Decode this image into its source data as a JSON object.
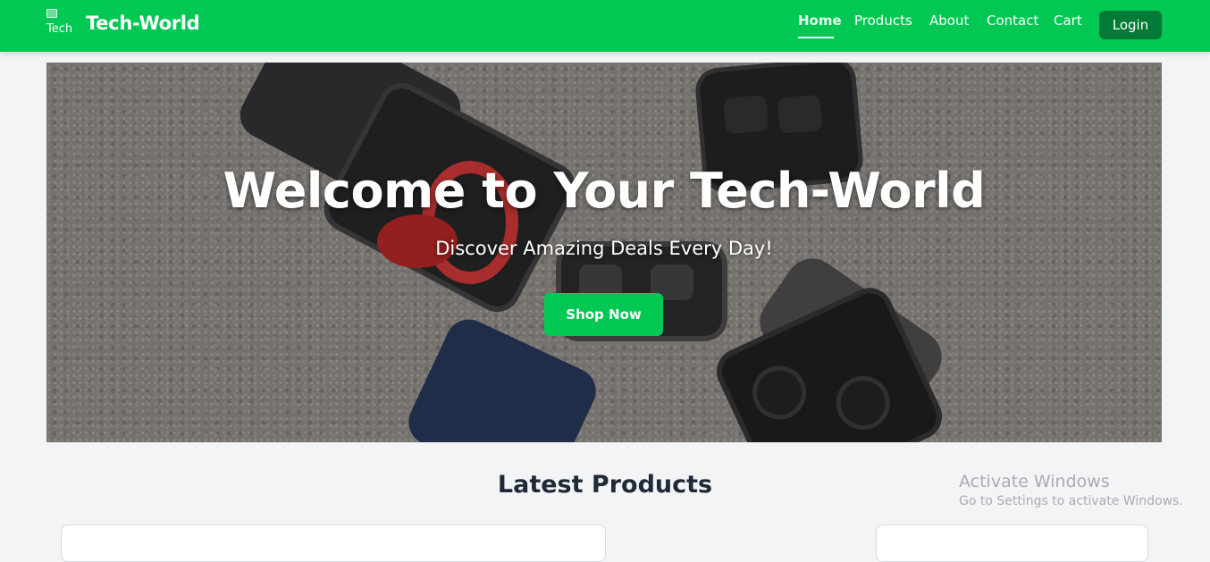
{
  "nav": {
    "logo_alt": "Tech",
    "brand": "Tech-World",
    "links": [
      "Home",
      "Products",
      "About",
      "Contact",
      "Cart"
    ],
    "active_link": "Home",
    "login_label": "Login"
  },
  "hero": {
    "title": "Welcome to Your Tech-World",
    "subtitle": "Discover Amazing Deals Every Day!",
    "cta_label": "Shop Now"
  },
  "products": {
    "section_title": "Latest Products"
  },
  "watermark": {
    "title": "Activate Windows",
    "subtitle": "Go to Settings to activate Windows."
  },
  "colors": {
    "brand_green": "#00c853",
    "login_green": "#007a34",
    "page_bg": "#f3f4f6"
  }
}
